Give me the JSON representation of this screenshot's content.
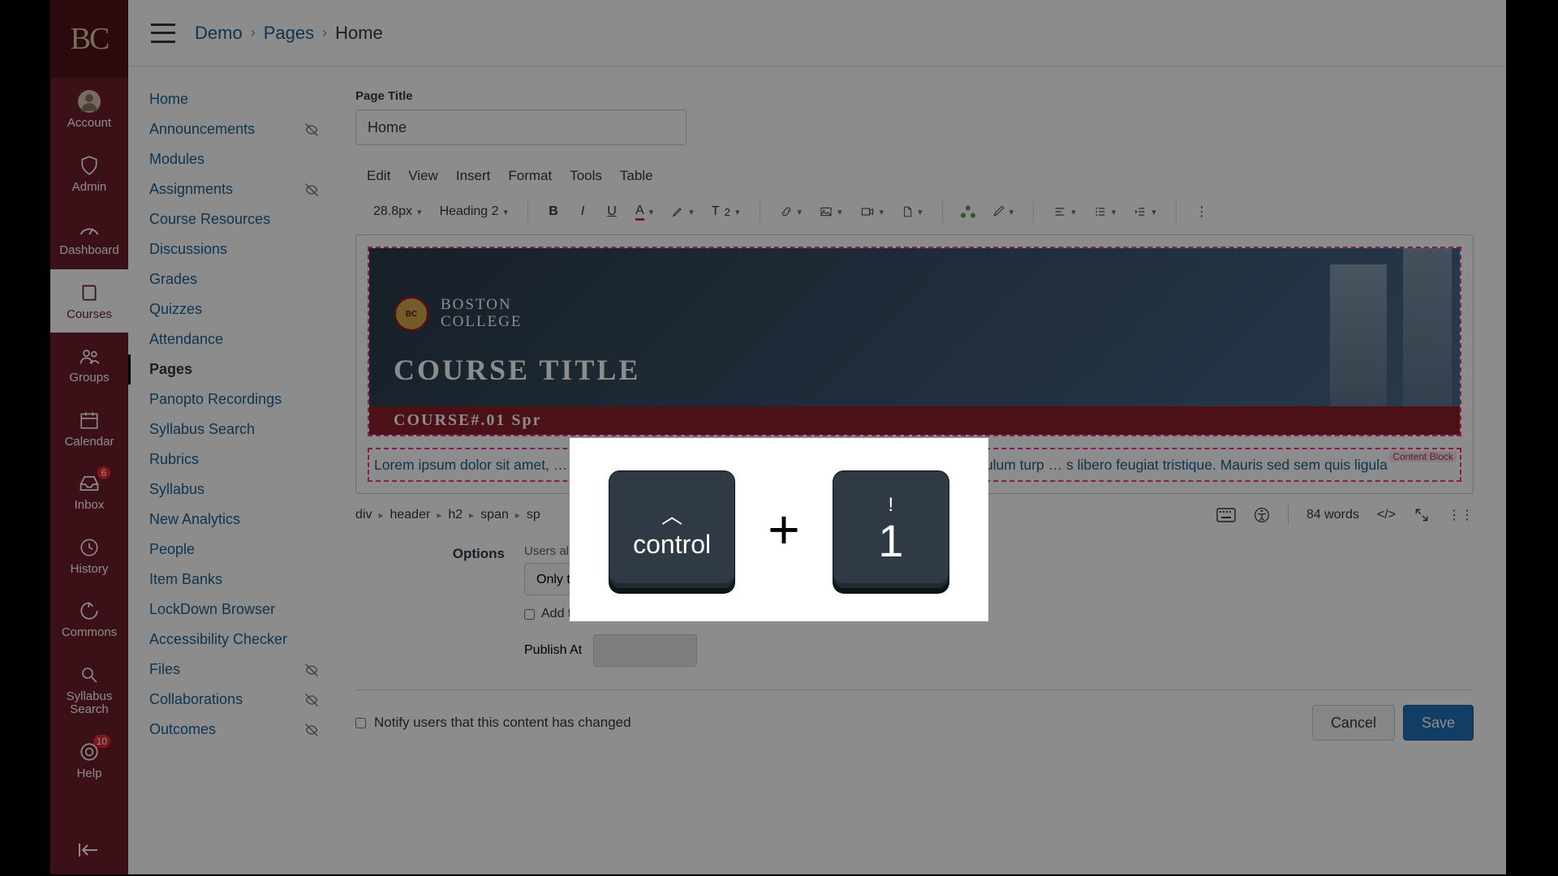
{
  "globalNav": {
    "logo": "BC",
    "items": [
      {
        "key": "account",
        "label": "Account",
        "icon": "avatar"
      },
      {
        "key": "admin",
        "label": "Admin",
        "icon": "shield"
      },
      {
        "key": "dashboard",
        "label": "Dashboard",
        "icon": "gauge"
      },
      {
        "key": "courses",
        "label": "Courses",
        "icon": "book",
        "active": true
      },
      {
        "key": "groups",
        "label": "Groups",
        "icon": "group"
      },
      {
        "key": "calendar",
        "label": "Calendar",
        "icon": "calendar"
      },
      {
        "key": "inbox",
        "label": "Inbox",
        "icon": "inbox",
        "badge": "6"
      },
      {
        "key": "history",
        "label": "History",
        "icon": "clock"
      },
      {
        "key": "commons",
        "label": "Commons",
        "icon": "commons"
      },
      {
        "key": "syllabus-search",
        "label": "Syllabus Search",
        "icon": "magnify"
      },
      {
        "key": "help",
        "label": "Help",
        "icon": "life-ring",
        "badge": "10"
      }
    ]
  },
  "breadcrumb": {
    "a": "Demo",
    "b": "Pages",
    "c": "Home"
  },
  "courseNav": [
    {
      "label": "Home"
    },
    {
      "label": "Announcements",
      "hidden": true
    },
    {
      "label": "Modules"
    },
    {
      "label": "Assignments",
      "hidden": true
    },
    {
      "label": "Course Resources"
    },
    {
      "label": "Discussions"
    },
    {
      "label": "Grades"
    },
    {
      "label": "Quizzes"
    },
    {
      "label": "Attendance"
    },
    {
      "label": "Pages",
      "active": true
    },
    {
      "label": "Panopto Recordings"
    },
    {
      "label": "Syllabus Search"
    },
    {
      "label": "Rubrics"
    },
    {
      "label": "Syllabus"
    },
    {
      "label": "New Analytics"
    },
    {
      "label": "People"
    },
    {
      "label": "Item Banks"
    },
    {
      "label": "LockDown Browser"
    },
    {
      "label": "Accessibility Checker"
    },
    {
      "label": "Files",
      "hidden": true
    },
    {
      "label": "Collaborations",
      "hidden": true
    },
    {
      "label": "Outcomes",
      "hidden": true
    }
  ],
  "editor": {
    "pageTitleLabel": "Page Title",
    "pageTitleValue": "Home",
    "menu": [
      "Edit",
      "View",
      "Insert",
      "Format",
      "Tools",
      "Table"
    ],
    "fontSize": "28.8px",
    "heading": "Heading 2",
    "banner": {
      "school": "BOSTON\nCOLLEGE",
      "title": "COURSE TITLE",
      "footer": "COURSE#.01 Spr"
    },
    "contentBlockLabel": "Content Block",
    "paragraph": "Lorem ipsum dolor sit amet, … commodo libero vel lacus consectetur feugiat. Phasellus ac vestibulum turp … s libero feugiat tristique. Mauris sed sem quis ligula",
    "path": [
      "div",
      "header",
      "h2",
      "span",
      "sp"
    ],
    "wordCount": "84 words"
  },
  "options": {
    "sectionLabel": "Options",
    "usersLabel": "Users allowed to edit this page",
    "usersValue": "Only teachers",
    "todoLabel": "Add to student to-do",
    "publishLabel": "Publish At"
  },
  "footer": {
    "notifyLabel": "Notify users that this content has changed",
    "cancel": "Cancel",
    "save": "Save"
  },
  "kbd": {
    "key1top": "︿",
    "key1": "control",
    "plus": "+",
    "key2top": "!",
    "key2": "1"
  }
}
